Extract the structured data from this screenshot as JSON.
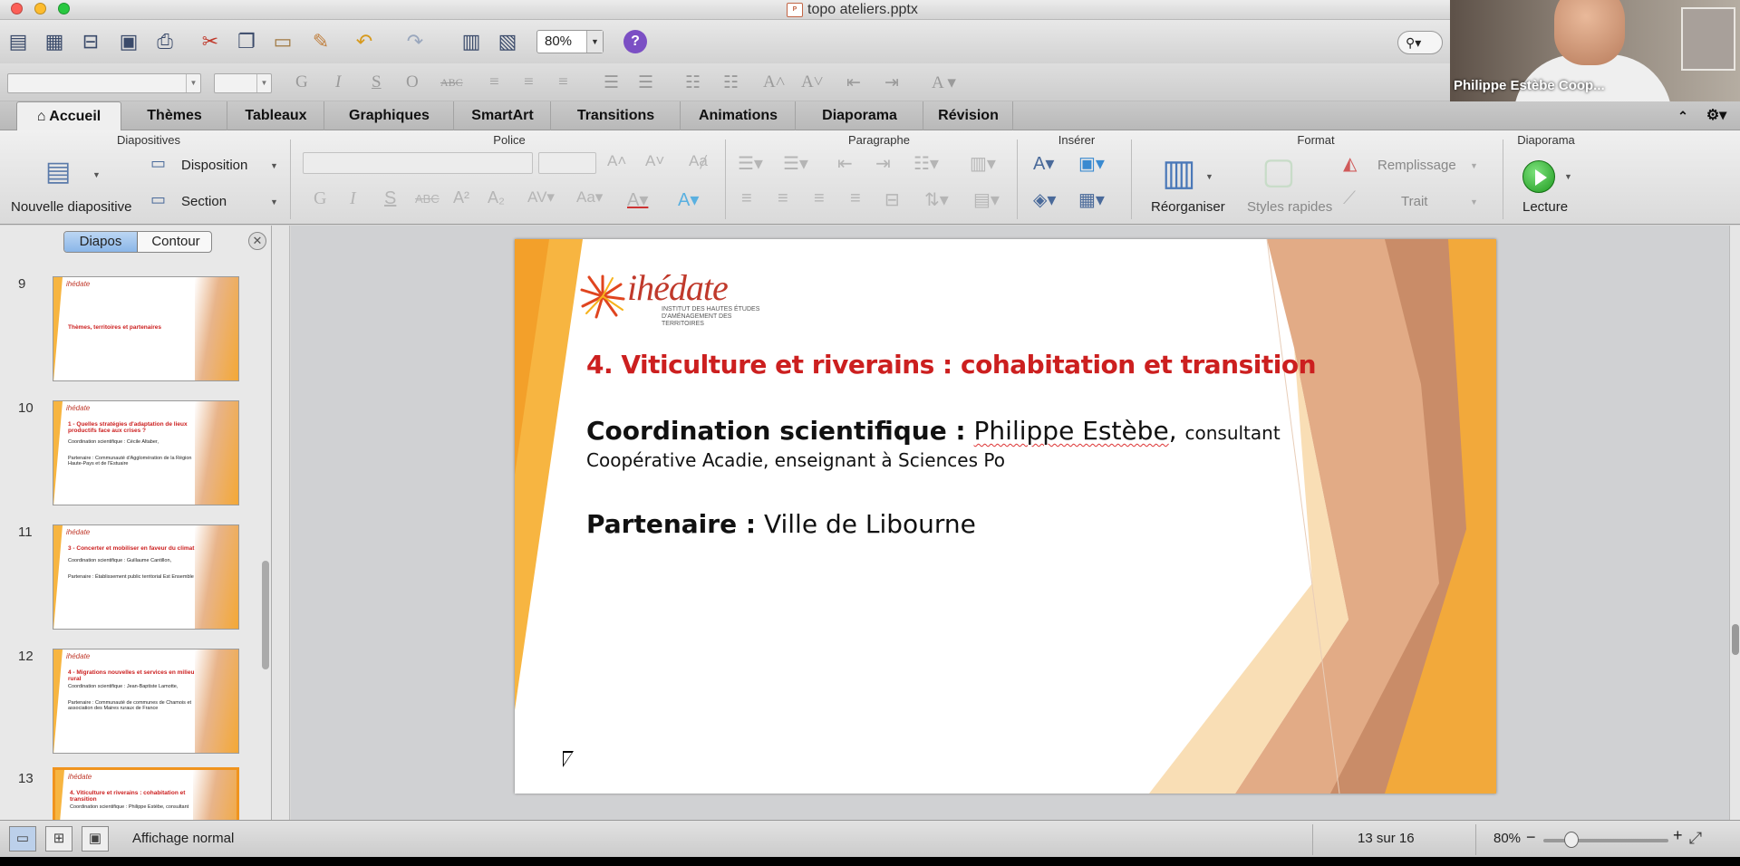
{
  "window": {
    "title": "topo ateliers.pptx",
    "doc_badge": "P"
  },
  "toolbar": {
    "zoom": "80%",
    "help": "?",
    "search_icon": "search-icon"
  },
  "tabs": [
    {
      "label": "Accueil"
    },
    {
      "label": "Thèmes"
    },
    {
      "label": "Tableaux"
    },
    {
      "label": "Graphiques"
    },
    {
      "label": "SmartArt"
    },
    {
      "label": "Transitions"
    },
    {
      "label": "Animations"
    },
    {
      "label": "Diaporama"
    },
    {
      "label": "Révision"
    }
  ],
  "ribbon": {
    "groups": {
      "diapositives": "Diapositives",
      "police": "Police",
      "paragraphe": "Paragraphe",
      "inserer": "Insérer",
      "format": "Format",
      "diaporama": "Diaporama"
    },
    "nouvelle_diapositive": "Nouvelle diapositive",
    "disposition": "Disposition",
    "section": "Section",
    "reorganiser": "Réorganiser",
    "styles_rapides": "Styles rapides",
    "remplissage": "Remplissage",
    "trait": "Trait",
    "lecture": "Lecture"
  },
  "sidebar": {
    "seg_slides": "Diapos",
    "seg_outline": "Contour",
    "thumbnails": [
      {
        "num": "9",
        "title": "Thèmes, territoires et partenaires",
        "lines": []
      },
      {
        "num": "10",
        "title": "1 - Quelles stratégies d'adaptation de lieux productifs face aux crises ?",
        "lines": [
          "Coordination scientifique : Cécile Altaber,",
          "Partenaire : Communauté d'Agglomération de la Région Haute-Pays et de l'Estuaire"
        ]
      },
      {
        "num": "11",
        "title": "3 - Concerter et mobiliser en faveur du climat",
        "lines": [
          "Coordination scientifique : Guillaume Cantillon,",
          "Partenaire : Établissement public territorial Est Ensemble"
        ]
      },
      {
        "num": "12",
        "title": "4 - Migrations nouvelles et services en milieu rural",
        "lines": [
          "Coordination scientifique : Jean-Baptiste Lamotte,",
          "Partenaire : Communauté de communes de Chamois et association des Maires ruraux de France"
        ]
      },
      {
        "num": "13",
        "title": "4. Viticulture et riverains : cohabitation et transition",
        "lines": [
          "Coordination scientifique : Philippe Estèbe, consultant"
        ]
      }
    ]
  },
  "slide": {
    "logo": "ihédate",
    "logo_sub": "INSTITUT DES HAUTES ÉTUDES D'AMÉNAGEMENT DES TERRITOIRES",
    "title": "4. Viticulture et riverains : cohabitation et transition",
    "coord_label": "Coordination scientifique :",
    "coord_name": "Philippe Estèbe",
    "coord_role": "consultant",
    "coord_line2": "Coopérative Acadie, enseignant à Sciences Po",
    "partner_label": "Partenaire :",
    "partner_name": "Ville de Libourne"
  },
  "status": {
    "view": "Affichage normal",
    "page": "13 sur 16",
    "zoom": "80%",
    "zoom_level_percent": 80
  },
  "webcam": {
    "name": "Philippe Estèbe Coop..."
  },
  "colors": {
    "title_red": "#cc1f1f",
    "accent_orange": "#f7b541",
    "selection": "#f0941e"
  }
}
